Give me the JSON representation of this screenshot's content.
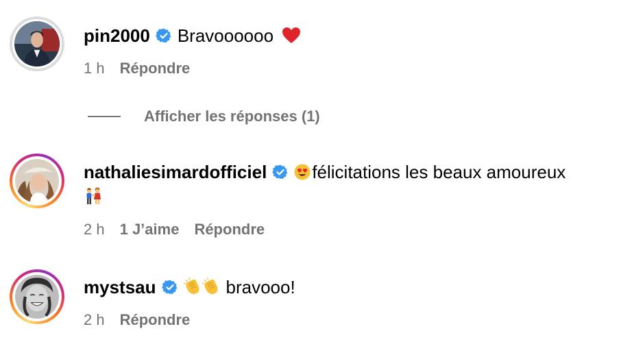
{
  "comments": [
    {
      "username": "pin2000",
      "text": "Bravoooooo",
      "emoji_after": "heart-icon",
      "time": "1 h",
      "likes": "",
      "reply_label": "Répondre",
      "verified": true
    },
    {
      "username": "nathaliesimardofficiel",
      "text": "félicitations les beaux amoureux",
      "emoji_before": "heart-eyes-icon",
      "emoji_line2": "couple-holding-hands-icon",
      "time": "2 h",
      "likes": "1 J’aime",
      "reply_label": "Répondre",
      "verified": true
    },
    {
      "username": "mystsau",
      "text": "bravooo!",
      "emoji_before": "clapping-hands-icon",
      "time": "2 h",
      "likes": "",
      "reply_label": "Répondre",
      "verified": true
    }
  ],
  "view_replies": {
    "label": "Afficher les réponses (1)"
  },
  "colors": {
    "verified_blue": "#3897f0",
    "meta_grey": "#737373",
    "ring_grey": "#dbdbdb"
  }
}
